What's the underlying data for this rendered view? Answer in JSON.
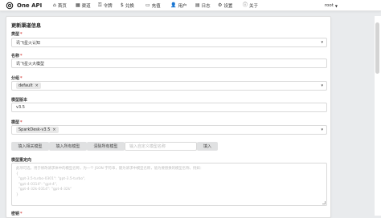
{
  "app": {
    "name": "One API"
  },
  "nav": [
    {
      "icon": "home-icon",
      "glyph": "⌂",
      "label": "首页"
    },
    {
      "icon": "channel-icon",
      "glyph": "▦",
      "label": "渠道"
    },
    {
      "icon": "key-icon",
      "glyph": "⚿",
      "label": "令牌"
    },
    {
      "icon": "dollar-icon",
      "glyph": "$",
      "label": "兑换"
    },
    {
      "icon": "card-icon",
      "glyph": "▭",
      "label": "充值"
    },
    {
      "icon": "user-icon",
      "glyph": "👤",
      "label": "用户"
    },
    {
      "icon": "log-icon",
      "glyph": "▤",
      "label": "日志"
    },
    {
      "icon": "gear-icon",
      "glyph": "⚙",
      "label": "设置"
    },
    {
      "icon": "info-icon",
      "glyph": "ⓘ",
      "label": "关于"
    }
  ],
  "user": {
    "name": "root"
  },
  "form": {
    "title": "更新渠道信息",
    "type": {
      "label": "类型",
      "value": "讯飞星火认知"
    },
    "name": {
      "label": "名称",
      "value": "讯飞星火大模型"
    },
    "group": {
      "label": "分组",
      "chip": "default"
    },
    "version": {
      "label": "模型版本",
      "value": "v3.5"
    },
    "models": {
      "label": "模型",
      "chip": "SparkDesk-v3.5"
    },
    "buttons": {
      "fill_related": "填入相关模型",
      "fill_all": "填入所有模型",
      "clear_all": "清除所有模型",
      "fill": "填入"
    },
    "custom_model_placeholder": "输入自定义模型名称",
    "mapping": {
      "label": "模型重定向",
      "placeholder": "此项可选，用于修改请求体中的模型名称，为一个 JSON 字符串，键为请求中模型名称，值为要替换的模型名称，例如：\n{\n  \"gpt-3.5-turbo-0301\": \"gpt-3.5-turbo\",\n  \"gpt-4-0314\": \"gpt-4\",\n  \"gpt-4-32k-0314\": \"gpt-4-32k\"\n}"
    },
    "next_label": "密钥"
  }
}
